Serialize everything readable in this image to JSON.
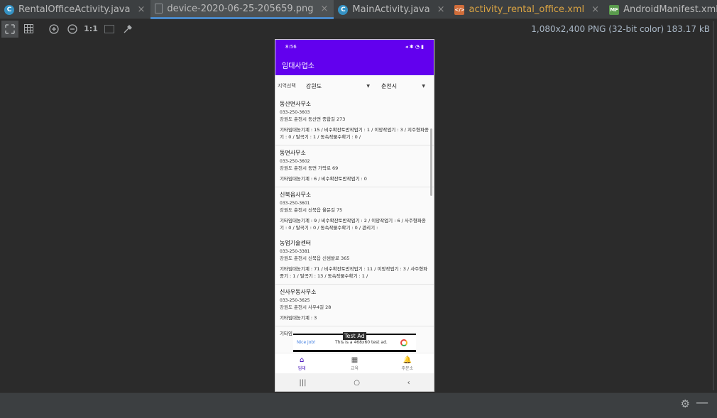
{
  "tabs": [
    {
      "label": "RentalOfficeActivity.java",
      "icon": "C",
      "kind": "java",
      "active": false
    },
    {
      "label": "device-2020-06-25-205659.png",
      "icon": "",
      "kind": "png",
      "active": true
    },
    {
      "label": "MainActivity.java",
      "icon": "C",
      "kind": "java",
      "active": false
    },
    {
      "label": "activity_rental_office.xml",
      "icon": "</>",
      "kind": "xml",
      "active": false
    },
    {
      "label": "AndroidManifest.xml",
      "icon": "MF",
      "kind": "mf",
      "active": false
    }
  ],
  "tab_close_glyph": "×",
  "toolbar": {
    "one_to_one": "1:1",
    "image_info": "1,080x2,400 PNG (32-bit color) 183.17 kB"
  },
  "phone": {
    "status_time": "8:56",
    "status_icons": "◂ ✱ ◔ ▮",
    "app_title": "임대사업소",
    "filter": {
      "label": "지역선택",
      "province": "강원도",
      "city": "춘천시"
    },
    "offices": [
      {
        "name": "동산면사무소",
        "phone": "033-250-3603",
        "address": "강원도 춘천시 동산면 종합길 273",
        "machines": "기타임대농기계 : 15 / 비수확잔토반작업기 : 1 / 이앙작업기 : 3 / 지주형파종기 : 0 / 탈곡기 : 1 / 동속작물수확기 : 0 /"
      },
      {
        "name": "동면사무소",
        "phone": "033-250-3602",
        "address": "강원도 춘천시 동면 가락로 69",
        "machines": "기타임대농기계 : 6 / 비수확잔토반작업기 : 0"
      },
      {
        "name": "신북읍사무소",
        "phone": "033-250-3601",
        "address": "강원도 춘천시 신북읍 율문길 75",
        "machines": "기타임대농기계 : 9 / 비수확잔토반작업기 : 2 / 이앙작업기 : 6 / 사주형파종기 : 0 / 탈곡기 : 0 / 동속작물수확기 : 0 / 관리기 :"
      },
      {
        "name": "농업기술센터",
        "phone": "033-250-3381",
        "address": "강원도 춘천시 신북읍 신샘밭로 365",
        "machines": "기타임대농기계 : 71 / 비수확잔토반작업기 : 11 / 이앙작업기 : 3 / 사주형파종기 : 1 / 탈곡기 : 13 / 동속작물수확기 : 1 /"
      },
      {
        "name": "신사우동사무소",
        "phone": "033-250-3625",
        "address": "강원도 춘천시 사우4길 28",
        "machines": "기타임대농기계 : 3"
      },
      {
        "name": "",
        "phone": "",
        "address": "",
        "machines": "기타임"
      }
    ],
    "ad": {
      "tag": "Test Ad",
      "nice": "Nice job!",
      "text": "This is a 468x60 test ad."
    },
    "bottom_nav": [
      {
        "label": "임대",
        "icon": "⌂",
        "active": true
      },
      {
        "label": "교육",
        "icon": "▦",
        "active": false
      },
      {
        "label": "주문소",
        "icon": "🔔",
        "active": false
      }
    ],
    "system_nav": {
      "recents": "|||",
      "home": "○",
      "back": "‹"
    }
  }
}
